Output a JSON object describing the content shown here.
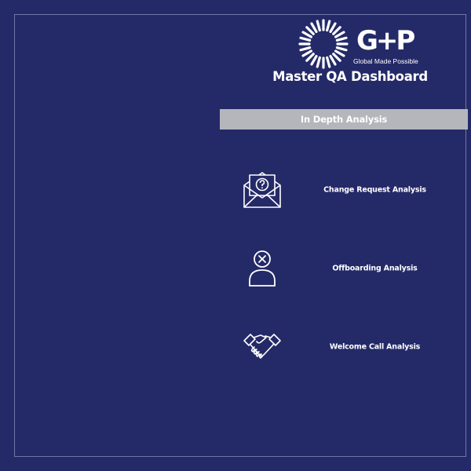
{
  "brand": {
    "logo_mark": "G+P",
    "tagline": "Global Made Possible"
  },
  "header": {
    "title": "Master QA Dashboard"
  },
  "section": {
    "title": "In Depth Analysis"
  },
  "nav_items": [
    {
      "label": "Change Request Analysis",
      "icon": "envelope-question-icon"
    },
    {
      "label": "Offboarding Analysis",
      "icon": "user-remove-icon"
    },
    {
      "label": "Welcome Call Analysis",
      "icon": "handshake-icon"
    }
  ],
  "colors": {
    "background": "#242a68",
    "frame_border": "#6f77a6",
    "section_header_bg": "#b4b6bc",
    "text": "#ffffff"
  }
}
